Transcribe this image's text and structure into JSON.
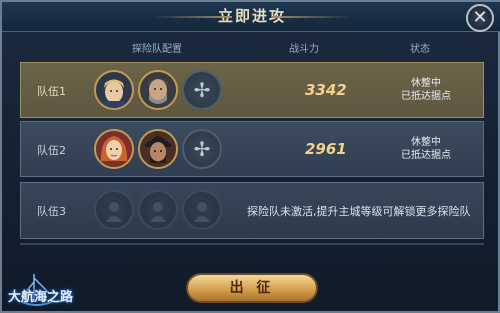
{
  "dialog": {
    "title": "立即进攻",
    "close_label": "✕"
  },
  "columns": {
    "team": "探险队配置",
    "power": "战斗力",
    "status": "状态"
  },
  "teams": [
    {
      "label": "队伍1",
      "power": "3342",
      "status_line1": "休整中",
      "status_line2": "已抵达据点",
      "selected": true
    },
    {
      "label": "队伍2",
      "power": "2961",
      "status_line1": "休整中",
      "status_line2": "已抵达据点",
      "selected": false
    },
    {
      "label": "队伍3",
      "locked_message": "探险队未激活,提升主城等级可解锁更多探险队"
    }
  ],
  "action_button": "出 征",
  "logo_text": "大航海之路",
  "colors": {
    "selected_row": "#655d44",
    "row": "#35465a",
    "power_text": "#f2d38a",
    "button_gold": "#d6a04e"
  }
}
